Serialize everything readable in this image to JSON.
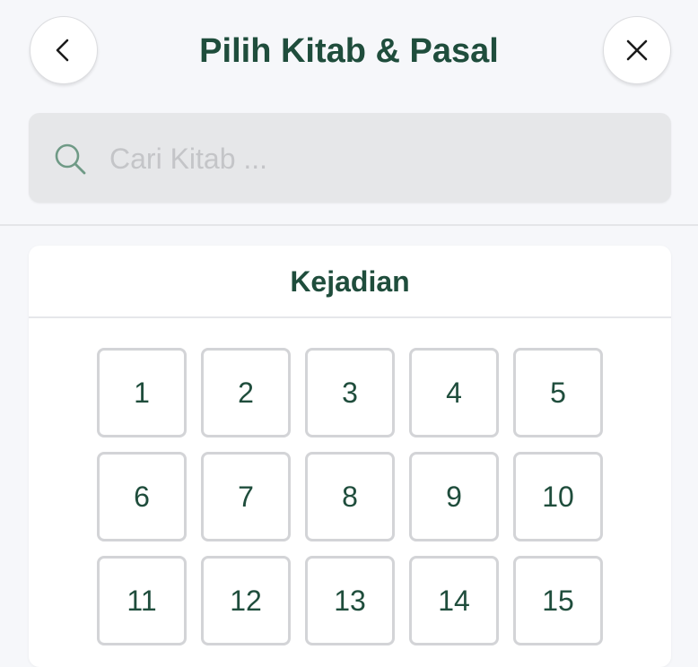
{
  "header": {
    "title": "Pilih Kitab & Pasal",
    "back_icon": "chevron-left-icon",
    "close_icon": "close-icon"
  },
  "search": {
    "placeholder": "Cari Kitab ...",
    "value": "",
    "icon": "search-icon"
  },
  "book": {
    "name": "Kejadian",
    "chapters": [
      "1",
      "2",
      "3",
      "4",
      "5",
      "6",
      "7",
      "8",
      "9",
      "10",
      "11",
      "12",
      "13",
      "14",
      "15"
    ]
  },
  "colors": {
    "accent": "#1f4d3c",
    "background": "#f6f7fa",
    "search_bg": "#e6e7e9",
    "chapter_border": "#d3d4d7"
  }
}
